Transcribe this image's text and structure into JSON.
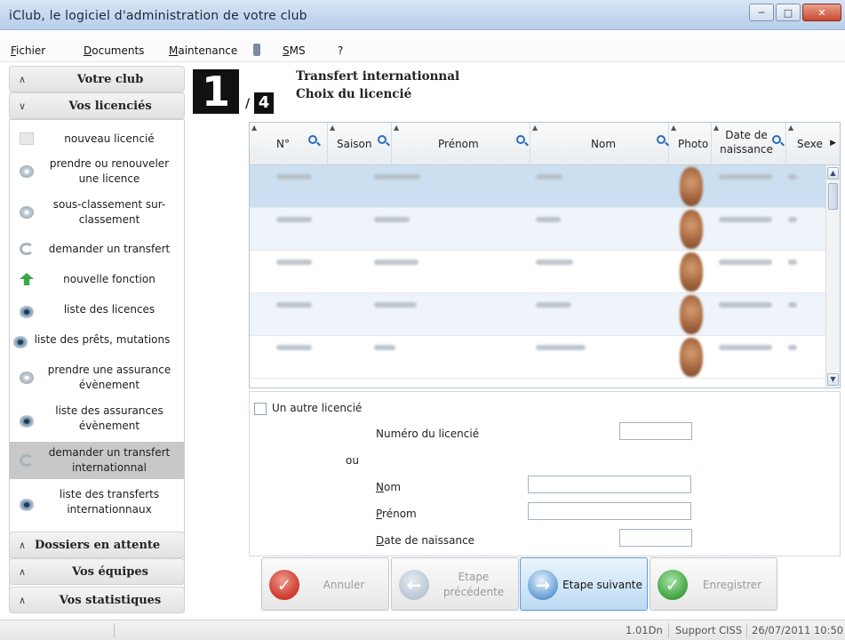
{
  "window": {
    "title": "iClub, le logiciel d'administration de votre club",
    "buttons": [
      "minimize",
      "maximize",
      "close"
    ]
  },
  "menu": {
    "items": [
      {
        "label": "Fichier",
        "u": "F",
        "rest": "ichier"
      },
      {
        "label": "Documents",
        "u": "D",
        "rest": "ocuments"
      },
      {
        "label": "Maintenance",
        "u": "M",
        "rest": "aintenance"
      },
      {
        "label": "SMS",
        "u": "S",
        "rest": "MS"
      },
      {
        "label": "?",
        "u": "",
        "rest": "?"
      }
    ]
  },
  "sidebar": {
    "sections": [
      {
        "label": "Votre club",
        "state": "collapsed"
      },
      {
        "label": "Vos licenciés",
        "state": "expanded"
      },
      {
        "label": "Dossiers en attente",
        "state": "collapsed"
      },
      {
        "label": "Vos équipes",
        "state": "collapsed"
      },
      {
        "label": "Vos statistiques",
        "state": "collapsed"
      }
    ],
    "items": [
      {
        "label": "nouveau licencié",
        "icon": "document-icon"
      },
      {
        "label": "prendre ou renouveler une licence",
        "icon": "cd-icon"
      },
      {
        "label": "sous-classement sur-classement",
        "icon": "person-icon"
      },
      {
        "label": "demander un transfert",
        "icon": "arrows-icon"
      },
      {
        "label": "nouvelle fonction",
        "icon": "green-arrow-icon"
      },
      {
        "label": "liste des licences",
        "icon": "eye-icon"
      },
      {
        "label": "liste des prêts, mutations",
        "icon": "eye-icon"
      },
      {
        "label": "prendre une assurance évènement",
        "icon": "cd-icon"
      },
      {
        "label": "liste des assurances évènement",
        "icon": "eye-icon"
      },
      {
        "label": "demander un transfert internationnal",
        "icon": "arrows-icon",
        "active": true
      },
      {
        "label": "liste des transferts internationnaux",
        "icon": "eye-icon"
      }
    ]
  },
  "step": {
    "current": "1",
    "separator": "/",
    "total": "4",
    "title": "Transfert internationnal",
    "subtitle": "Choix du licencié"
  },
  "grid": {
    "columns": [
      "N°",
      "Saison",
      "Prénom",
      "Nom",
      "Photo",
      "Date de naissance",
      "Sexe"
    ],
    "rows": [
      {
        "prenom": "Aaro Erik",
        "selected": true
      },
      {
        "prenom": "Peter"
      },
      {
        "prenom": "Fredrik"
      },
      {
        "prenom": "Andreas"
      },
      {
        "prenom": "Joe"
      }
    ]
  },
  "form": {
    "other_checkbox_label": "Un autre licencié",
    "numero_label": "Numéro du licencié",
    "or_label": "ou",
    "nom_label": "Nom",
    "nom_u": "N",
    "nom_rest": "om",
    "prenom_u": "P",
    "prenom_rest": "rénom",
    "date_u": "D",
    "date_rest": "ate de naissance",
    "numero_value": "",
    "nom_value": "",
    "prenom_value": "",
    "date_value": ""
  },
  "buttons": {
    "cancel": "Annuler",
    "previous": "Etape précédente",
    "next": "Etape suivante",
    "save": "Enregistrer"
  },
  "status": {
    "version": "1.01Dn",
    "support": "Support CISS",
    "datetime": "26/07/2011 10:50"
  }
}
